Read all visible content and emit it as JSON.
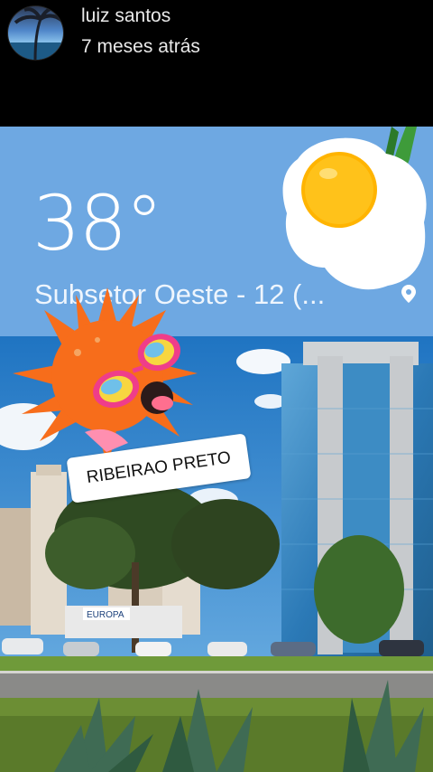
{
  "header": {
    "username": "luiz santos",
    "posted": "7 meses atrás"
  },
  "weather": {
    "temperature": "38°",
    "location": "Subsetor Oeste - 12 (..."
  },
  "photo": {
    "sign": "EUROPA"
  },
  "sticker": {
    "label": "RIBEIRAO PRETO"
  },
  "colors": {
    "card_bg": "#6ea8e2",
    "sun": "#f76d1b"
  },
  "icons": [
    "avatar",
    "fried-egg-sticker",
    "location-pin-icon",
    "sun-sticker"
  ]
}
